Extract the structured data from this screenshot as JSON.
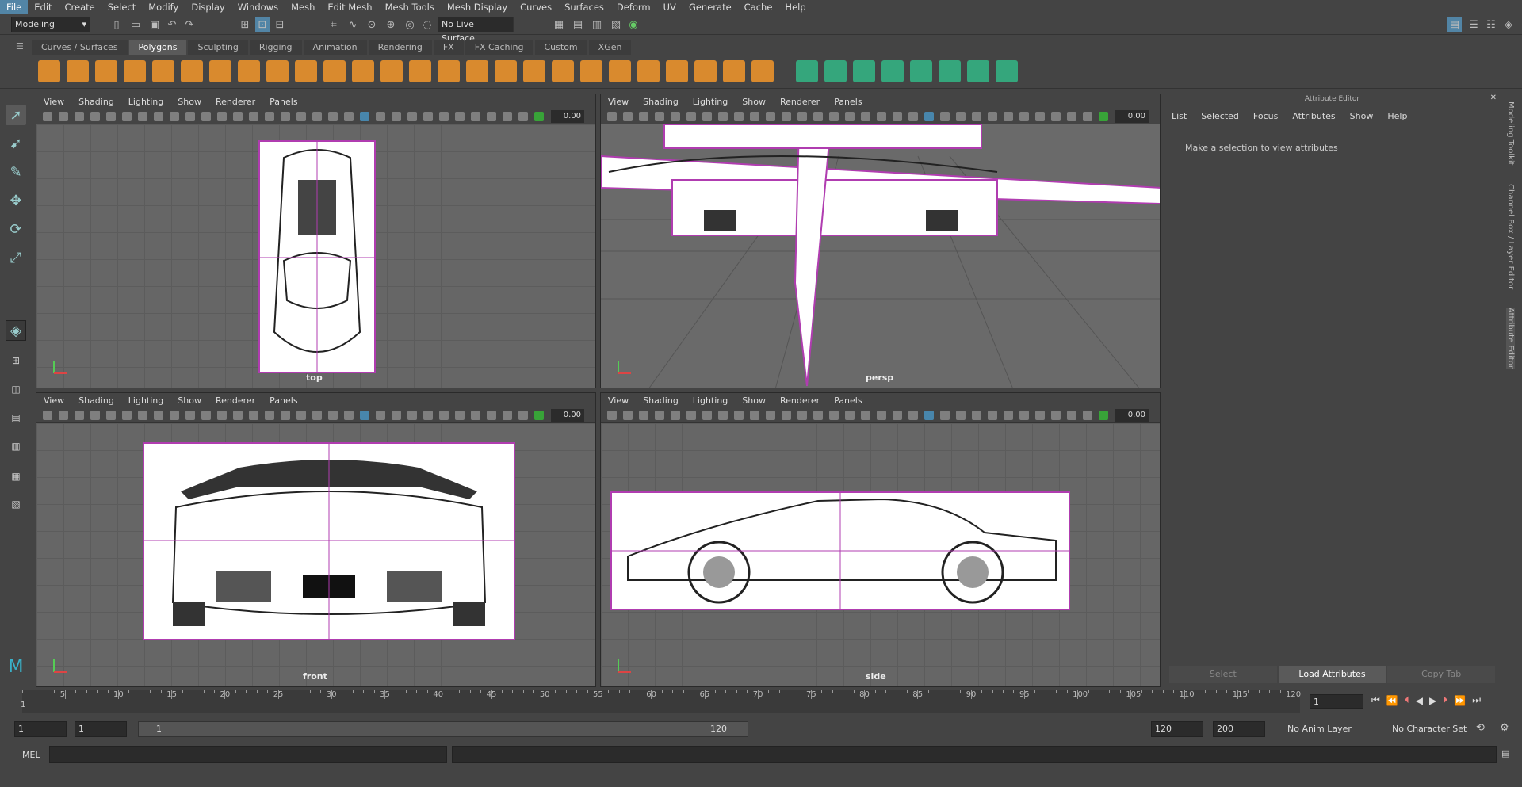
{
  "menubar": [
    "File",
    "Edit",
    "Create",
    "Select",
    "Modify",
    "Display",
    "Windows",
    "Mesh",
    "Edit Mesh",
    "Mesh Tools",
    "Mesh Display",
    "Curves",
    "Surfaces",
    "Deform",
    "UV",
    "Generate",
    "Cache",
    "Help"
  ],
  "status": {
    "menuset": "Modeling",
    "live_surface": "No Live Surface"
  },
  "shelf_tabs": [
    "Curves / Surfaces",
    "Polygons",
    "Sculpting",
    "Rigging",
    "Animation",
    "Rendering",
    "FX",
    "FX Caching",
    "Custom",
    "XGen"
  ],
  "shelf_active": "Polygons",
  "viewport_menu": [
    "View",
    "Shading",
    "Lighting",
    "Show",
    "Renderer",
    "Panels"
  ],
  "viewport_value": "0.00",
  "viewports": {
    "top": "top",
    "persp": "persp",
    "front": "front",
    "side": "side"
  },
  "attribute_editor": {
    "title": "Attribute Editor",
    "menu": [
      "List",
      "Selected",
      "Focus",
      "Attributes",
      "Show",
      "Help"
    ],
    "message": "Make a selection to view attributes",
    "buttons": [
      "Select",
      "Load Attributes",
      "Copy Tab"
    ]
  },
  "side_tabs": [
    "Modeling Toolkit",
    "Channel Box / Layer Editor",
    "Attribute Editor"
  ],
  "timeline": {
    "ticks": [
      "5",
      "10",
      "15",
      "20",
      "25",
      "30",
      "35",
      "40",
      "45",
      "50",
      "55",
      "60",
      "65",
      "70",
      "75",
      "80",
      "85",
      "90",
      "95",
      "100",
      "105",
      "110",
      "115",
      "120"
    ],
    "start_marker": "1",
    "current_frame": "1"
  },
  "range": {
    "start": "1",
    "playback_start": "1",
    "slider_start": "1",
    "slider_end": "120",
    "playback_end": "120",
    "end": "200",
    "anim_layer": "No Anim Layer",
    "character_set": "No Character Set"
  },
  "command_line": {
    "label": "MEL"
  },
  "colors": {
    "accent": "#5285a6",
    "plane_border": "#b03cb0",
    "viewport_bg": "#666666"
  }
}
